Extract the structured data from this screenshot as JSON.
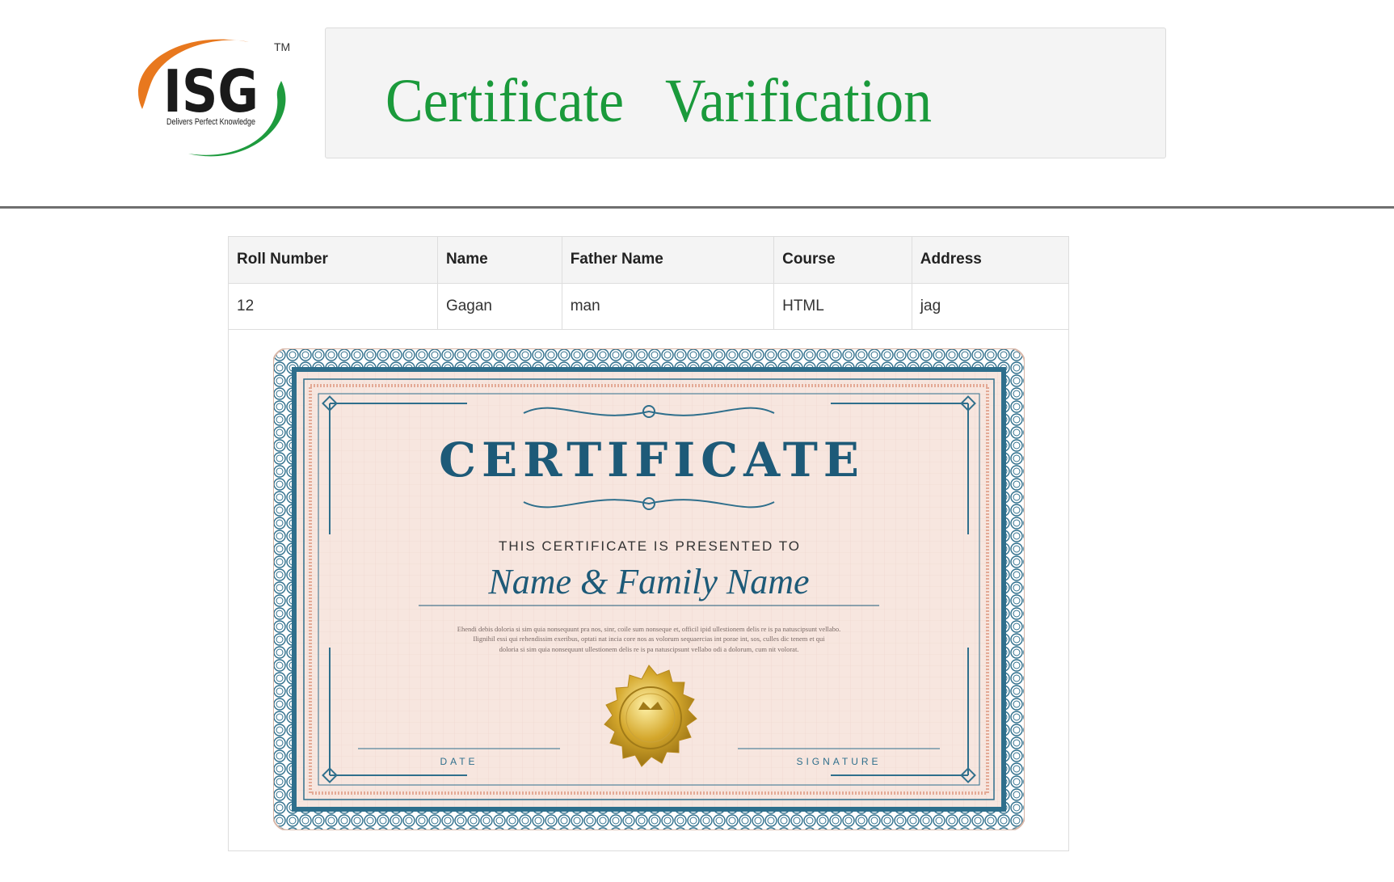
{
  "logo": {
    "brand": "ISG",
    "tagline": "Delivers Perfect Knowledge",
    "trademark": "TM",
    "colors": {
      "orange": "#e8781e",
      "green": "#1e9b3e",
      "text": "#1a1a1a"
    }
  },
  "header": {
    "title_word1": "Certificate",
    "title_word2": "Varification",
    "title_color": "#1a9a3b"
  },
  "table": {
    "columns": [
      "Roll Number",
      "Name",
      "Father Name",
      "Course",
      "Address"
    ],
    "rows": [
      [
        "12",
        "Gagan",
        "man",
        "HTML",
        "jag"
      ]
    ]
  },
  "certificate": {
    "heading": "CERTIFICATE",
    "presented_to": "THIS CERTIFICATE IS PRESENTED TO",
    "recipient": "Name & Family Name",
    "body_lines": [
      "Ehendi debis doloria si sim quia nonsequunt pra nos, sinr, coile sum nonseque et, officil ipid ullestionem delis re is pa natuscipsunt vellabo.",
      "Ilignihil essi qui rehendissim exeribus, optati nat incia core nos as volorum sequaercias int porae int, sos, culles dic tenem et qui",
      "doloria si sim quia nonsequunt ullestionem delis re is pa natuscipsunt vellabo odi a dolorum, cum nit volorat."
    ],
    "date_label": "DATE",
    "signature_label": "SIGNATURE",
    "colors": {
      "border": "#2f6f8c",
      "paper": "#f7e6df",
      "ink": "#1d5a78",
      "seal": "#d4a72c"
    }
  }
}
